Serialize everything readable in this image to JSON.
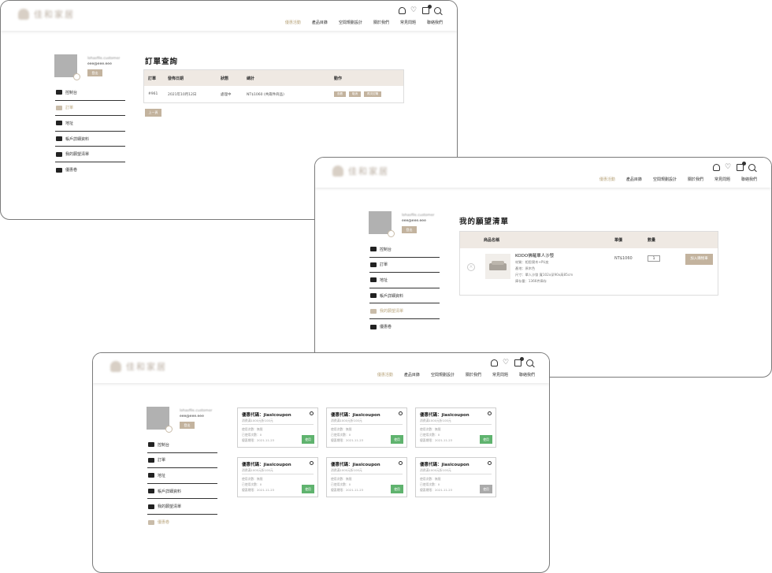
{
  "site": {
    "logo_text": "佳和家居",
    "nav": [
      "優惠活動",
      "產品目錄",
      "空間規劃設計",
      "關於我們",
      "常見問題",
      "聯絡我們"
    ],
    "cart_count": "0"
  },
  "profile": {
    "name": "lohasfile.customer",
    "email": "eee@eee.eee",
    "logout": "登出"
  },
  "menu": [
    "控制台",
    "訂單",
    "地址",
    "帳戶詳細資料",
    "我的願望清單",
    "優惠卷"
  ],
  "orders": {
    "title": "訂單查詢",
    "headers": [
      "訂單",
      "發佈日期",
      "狀態",
      "總計",
      "動作"
    ],
    "rows": [
      {
        "id": "#961",
        "date": "2021年10月12日",
        "status": "處理中",
        "total": "NT$1060 (共兩件商品)",
        "actions": [
          "查看",
          "取消",
          "再次訂購"
        ]
      }
    ],
    "back": "上一頁"
  },
  "wishlist": {
    "title": "我的願望清單",
    "headers": {
      "name": "商品名稱",
      "price": "單價",
      "qty": "數量"
    },
    "item": {
      "name": "KODO佛羅單人沙發",
      "desc": [
        "材質：相思實木+PU皮",
        "產地：原木色",
        "尺寸：單人沙發 寬102x深90x高85cm",
        "庫存量：1366件庫存"
      ],
      "price": "NT$1060",
      "qty": "1",
      "add": "加入購物車",
      "remove": "×"
    }
  },
  "coupons": {
    "items": [
      {
        "title": "優惠代碼：jiasicoupon",
        "sub": "消費滿1000元折100元",
        "d1": "使用次數：無限",
        "d2": "已使用次數：0",
        "d3": "優惠期限：2021-11-23",
        "btn": "使用",
        "enabled": true
      },
      {
        "title": "優惠代碼：jiasicoupon",
        "sub": "消費滿1000元折100元",
        "d1": "使用次數：無限",
        "d2": "已使用次數：0",
        "d3": "優惠期限：2021-11-23",
        "btn": "使用",
        "enabled": true
      },
      {
        "title": "優惠代碼：jiasicoupon",
        "sub": "消費滿1000元折100元",
        "d1": "使用次數：無限",
        "d2": "已使用次數：0",
        "d3": "優惠期限：2021-11-23",
        "btn": "使用",
        "enabled": true
      },
      {
        "title": "優惠代碼：jiasicoupon",
        "sub": "消費滿1000元折100元",
        "d1": "使用次數：無限",
        "d2": "已使用次數：0",
        "d3": "優惠期限：2021-11-23",
        "btn": "使用",
        "enabled": true
      },
      {
        "title": "優惠代碼：jiasicoupon",
        "sub": "消費滿1000元折100元",
        "d1": "使用次數：無限",
        "d2": "已使用次數：0",
        "d3": "優惠期限：2021-11-23",
        "btn": "使用",
        "enabled": true
      },
      {
        "title": "優惠代碼：jiasicoupon",
        "sub": "消費滿1000元折100元",
        "d1": "使用次數：無限",
        "d2": "已使用次數：0",
        "d3": "優惠期限：2021-11-23",
        "btn": "使用",
        "enabled": false
      }
    ]
  }
}
